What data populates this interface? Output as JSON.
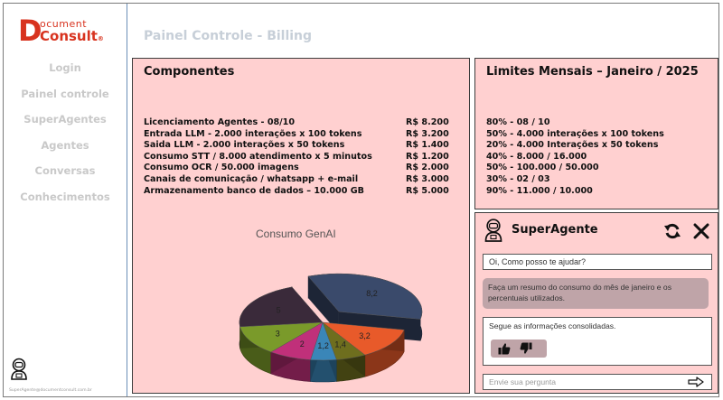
{
  "brand": {
    "logo_d": "D",
    "logo_top": "ocument",
    "logo_bottom": "Consult",
    "logo_mark": "®",
    "email": "SuperAgente@documentconsult.com.br"
  },
  "sidebar": {
    "items": [
      {
        "label": "Login"
      },
      {
        "label": "Painel controle"
      },
      {
        "label": "SuperAgentes"
      },
      {
        "label": "Agentes"
      },
      {
        "label": "Conversas"
      },
      {
        "label": "Conhecimentos"
      }
    ]
  },
  "header": {
    "title": "Painel Controle - Billing"
  },
  "components": {
    "title": "Componentes",
    "rows": [
      {
        "label": "Licenciamento Agentes  - 08/10",
        "price": "R$ 8.200"
      },
      {
        "label": "Entrada LLM - 2.000 interações x 100 tokens",
        "price": "R$ 3.200"
      },
      {
        "label": "Saida LLM - 2.000 interações x 50 tokens",
        "price": "R$ 1.400"
      },
      {
        "label": "Consumo STT / 8.000 atendimento x 5 minutos",
        "price": "R$ 1.200"
      },
      {
        "label": "Consumo OCR / 50.000 imagens",
        "price": "R$ 2.000"
      },
      {
        "label": "Canais de comunicação / whatsapp + e-mail",
        "price": "R$ 3.000"
      },
      {
        "label": "Armazenamento banco de dados – 10.000 GB",
        "price": "R$ 5.000"
      }
    ]
  },
  "limits": {
    "title": "Limites Mensais – Janeiro / 2025",
    "rows": [
      "80% - 08 / 10",
      "50% - 4.000 interações x 100 tokens",
      "20% - 4.000 Interações x 50 tokens",
      "40% - 8.000 / 16.000",
      "50% - 100.000 / 50.000",
      "30% - 02 / 03",
      "90% - 11.000 / 10.000"
    ]
  },
  "chart_data": {
    "type": "pie",
    "title": "Consumo GenAI",
    "three_d": true,
    "exploded_slice": "8,2",
    "slices": [
      {
        "label": "8,2",
        "value": 8.2,
        "color": "#3a4a6b"
      },
      {
        "label": "3,2",
        "value": 3.2,
        "color": "#e85a2a"
      },
      {
        "label": "1,4",
        "value": 1.4,
        "color": "#6e6e1e"
      },
      {
        "label": "1,2",
        "value": 1.2,
        "color": "#3a86b8"
      },
      {
        "label": "2",
        "value": 2,
        "color": "#c0307a"
      },
      {
        "label": "3",
        "value": 3,
        "color": "#7a9a2a"
      },
      {
        "label": "5",
        "value": 5,
        "color": "#3a2a3a"
      }
    ]
  },
  "agent": {
    "name": "SuperAgente",
    "greeting": "Oi, Como posso te ajudar?",
    "user_message": "Faça um resumo do consumo do mês de janeiro e os percentuais utilizados.",
    "reply": "Segue as informações consolidadas.",
    "input_placeholder": "Envie sua pergunta"
  }
}
